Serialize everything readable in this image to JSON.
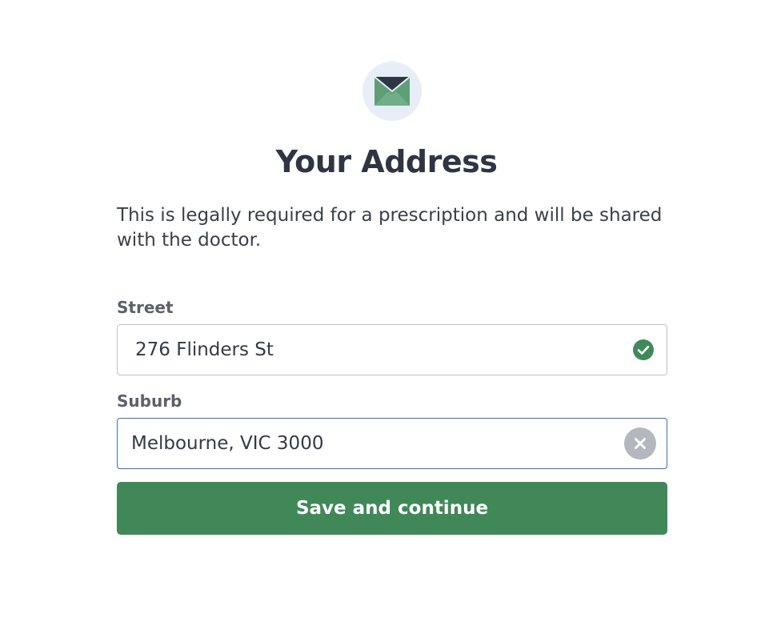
{
  "header": {
    "icon": "envelope-icon",
    "title": "Your Address",
    "description": "This is legally required for a prescription and will be shared with the doctor."
  },
  "form": {
    "street": {
      "label": "Street",
      "value": "276 Flinders St",
      "status_icon": "check-circle-icon"
    },
    "suburb": {
      "label": "Suburb",
      "value": "Melbourne, VIC 3000",
      "clear_icon": "close-icon"
    },
    "submit_label": "Save and continue"
  },
  "colors": {
    "accent": "#408858",
    "focus_border": "#3d6cc4",
    "icon_bg": "#e8eef8",
    "text": "#333a46"
  }
}
